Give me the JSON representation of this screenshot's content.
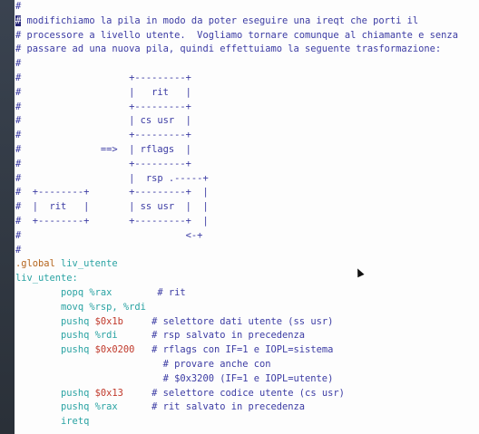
{
  "editor": {
    "lines": [
      [
        {
          "t": "#",
          "c": "comment"
        }
      ],
      [
        {
          "t": "#",
          "c": "cursor"
        },
        {
          "t": " modifichiamo la pila in modo da poter eseguire una ireqt che porti il",
          "c": "comment"
        }
      ],
      [
        {
          "t": "# processore a livello utente.  Vogliamo tornare comunque al chiamante e senza",
          "c": "comment"
        }
      ],
      [
        {
          "t": "# passare ad una nuova pila, quindi effettuiamo la seguente trasformazione:",
          "c": "comment"
        }
      ],
      [
        {
          "t": "#",
          "c": "comment"
        }
      ],
      [
        {
          "t": "#                   +---------+",
          "c": "comment"
        }
      ],
      [
        {
          "t": "#                   |   rit   |",
          "c": "comment"
        }
      ],
      [
        {
          "t": "#                   +---------+",
          "c": "comment"
        }
      ],
      [
        {
          "t": "#                   | cs usr  |",
          "c": "comment"
        }
      ],
      [
        {
          "t": "#                   +---------+",
          "c": "comment"
        }
      ],
      [
        {
          "t": "#              ==>  | rflags  |",
          "c": "comment"
        }
      ],
      [
        {
          "t": "#                   +---------+",
          "c": "comment"
        }
      ],
      [
        {
          "t": "#                   |  rsp .-----+",
          "c": "comment"
        }
      ],
      [
        {
          "t": "#  +--------+       +---------+  |",
          "c": "comment"
        }
      ],
      [
        {
          "t": "#  |  rit   |       | ss usr  |  |",
          "c": "comment"
        }
      ],
      [
        {
          "t": "#  +--------+       +---------+  |",
          "c": "comment"
        }
      ],
      [
        {
          "t": "#                             <-+",
          "c": "comment"
        }
      ],
      [
        {
          "t": "#",
          "c": "comment"
        }
      ],
      [
        {
          "t": ".global ",
          "c": "directive"
        },
        {
          "t": "liv_utente",
          "c": "label"
        }
      ],
      [
        {
          "t": "liv_utente:",
          "c": "label"
        }
      ],
      [
        {
          "t": "        popq ",
          "c": "instr"
        },
        {
          "t": "%rax",
          "c": "reg"
        },
        {
          "t": "        # rit",
          "c": "comment"
        }
      ],
      [
        {
          "t": "        movq ",
          "c": "instr"
        },
        {
          "t": "%rsp, %rdi",
          "c": "reg"
        }
      ],
      [
        {
          "t": "        pushq ",
          "c": "instr"
        },
        {
          "t": "$0x1b",
          "c": "imm"
        },
        {
          "t": "     # selettore dati utente (ss usr)",
          "c": "comment"
        }
      ],
      [
        {
          "t": "        pushq ",
          "c": "instr"
        },
        {
          "t": "%rdi",
          "c": "reg"
        },
        {
          "t": "      # rsp salvato in precedenza",
          "c": "comment"
        }
      ],
      [
        {
          "t": "        pushq ",
          "c": "instr"
        },
        {
          "t": "$0x0200",
          "c": "imm"
        },
        {
          "t": "   # rflags con IF=1 e IOPL=sistema",
          "c": "comment"
        }
      ],
      [
        {
          "t": "                          # provare anche con",
          "c": "comment"
        }
      ],
      [
        {
          "t": "                          # $0x3200 (IF=1 e IOPL=utente)",
          "c": "comment"
        }
      ],
      [
        {
          "t": "        pushq ",
          "c": "instr"
        },
        {
          "t": "$0x13",
          "c": "imm"
        },
        {
          "t": "     # selettore codice utente (cs usr)",
          "c": "comment"
        }
      ],
      [
        {
          "t": "        pushq ",
          "c": "instr"
        },
        {
          "t": "%rax",
          "c": "reg"
        },
        {
          "t": "      # rit salvato in precedenza",
          "c": "comment"
        }
      ],
      [
        {
          "t": "        iretq",
          "c": "instr"
        }
      ]
    ]
  },
  "colors": {
    "comment": "#3b3ba3",
    "directive": "#b5651d",
    "label": "#2aa3a3",
    "immediate": "#c0392b",
    "background": "#fdfdfd",
    "side_strip": "#2f3640"
  },
  "icons": {
    "mouse_pointer": "arrow-cursor-icon"
  }
}
